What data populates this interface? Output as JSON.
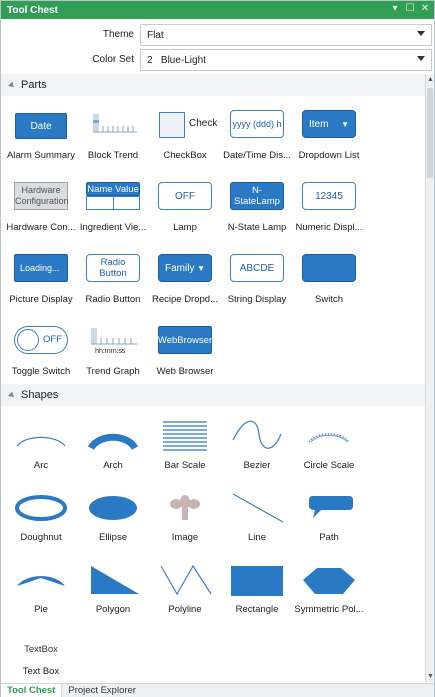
{
  "window": {
    "title": "Tool Chest",
    "ctrl_pin": "▾",
    "ctrl_max": "☐",
    "ctrl_close": "✕"
  },
  "settings": {
    "theme_label": "Theme",
    "theme_value": "Flat",
    "colorset_label": "Color Set",
    "colorset_value": "2   Blue-Light"
  },
  "parts": {
    "header": "Parts",
    "items": [
      {
        "name": "Alarm Summary",
        "icon_text": "Date"
      },
      {
        "name": "Block Trend"
      },
      {
        "name": "CheckBox",
        "icon_text": "Check"
      },
      {
        "name": "Date/Time Dis...",
        "icon_text": "yyyy (ddd) h"
      },
      {
        "name": "Dropdown List",
        "icon_text": "Item"
      },
      {
        "name": "Hardware Con...",
        "icon_text": "Hardware Configuration"
      },
      {
        "name": "Ingredient Vie...",
        "icon_text": "Name Value"
      },
      {
        "name": "Lamp",
        "icon_text": "OFF"
      },
      {
        "name": "N-State Lamp",
        "icon_text": "N-StateLamp"
      },
      {
        "name": "Numeric Displ...",
        "icon_text": "12345"
      },
      {
        "name": "Picture Display",
        "icon_text": "Loading..."
      },
      {
        "name": "Radio Button",
        "icon_text": "Radio Button"
      },
      {
        "name": "Recipe Dropd...",
        "icon_text": "Family"
      },
      {
        "name": "String Display",
        "icon_text": "ABCDE"
      },
      {
        "name": "Switch"
      },
      {
        "name": "Toggle Switch",
        "icon_text": "OFF"
      },
      {
        "name": "Trend Graph",
        "icon_text": "hh:mm:ss"
      },
      {
        "name": "Web Browser",
        "icon_text": "WebBrowser"
      }
    ]
  },
  "shapes": {
    "header": "Shapes",
    "items": [
      {
        "name": "Arc"
      },
      {
        "name": "Arch"
      },
      {
        "name": "Bar Scale"
      },
      {
        "name": "Bezier"
      },
      {
        "name": "Circle Scale"
      },
      {
        "name": "Doughnut"
      },
      {
        "name": "Ellipse"
      },
      {
        "name": "Image"
      },
      {
        "name": "Line"
      },
      {
        "name": "Path"
      },
      {
        "name": "Pie"
      },
      {
        "name": "Polygon"
      },
      {
        "name": "Polyline"
      },
      {
        "name": "Rectangle"
      },
      {
        "name": "Symmetric Pol..."
      },
      {
        "name": "Text Box",
        "icon_text": "TextBox"
      }
    ]
  },
  "tabs": [
    {
      "label": "Tool Chest"
    },
    {
      "label": "Project Explorer"
    }
  ],
  "colors": {
    "accent": "#2f9f56",
    "blue": "#2a79c4"
  }
}
